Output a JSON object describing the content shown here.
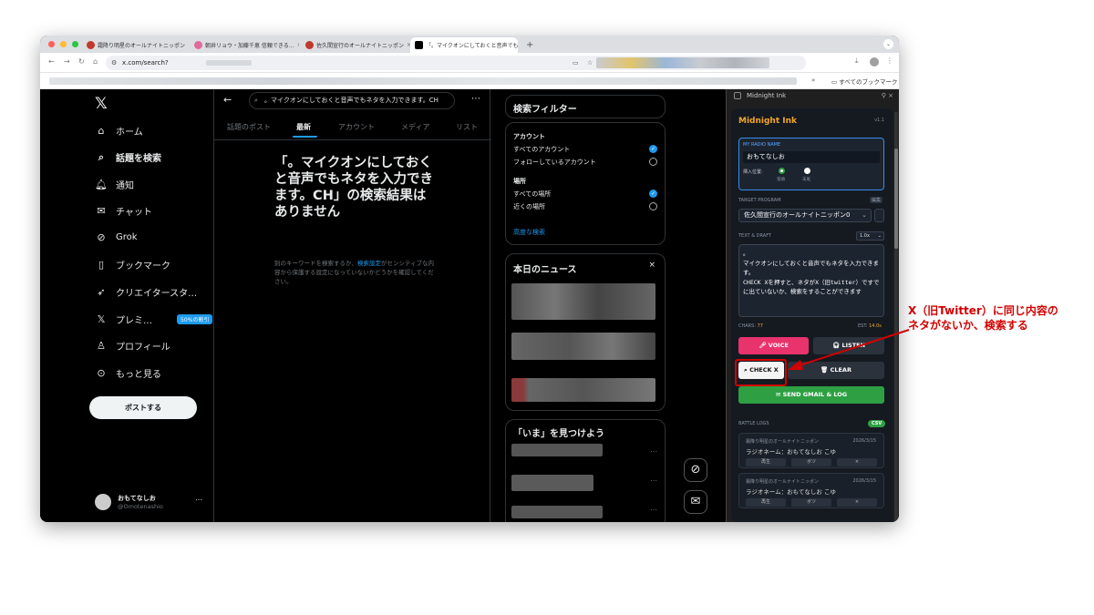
{
  "browser": {
    "tabs": [
      {
        "label": "霜降り明星のオールナイトニッポン"
      },
      {
        "label": "朝井リョウ・加藤千恵 信頼できる…"
      },
      {
        "label": "佐久間宣行のオールナイトニッポン"
      },
      {
        "label": "「。マイクオンにしておくと音声でも…"
      }
    ],
    "url": "x.com/search?",
    "bookmarks_all": "すべてのブックマーク"
  },
  "sidebar": {
    "items": [
      {
        "label": "ホーム",
        "icon": "home-icon"
      },
      {
        "label": "話題を検索",
        "icon": "search-icon"
      },
      {
        "label": "通知",
        "icon": "bell-icon"
      },
      {
        "label": "チャット",
        "icon": "mail-icon"
      },
      {
        "label": "Grok",
        "icon": "grok-icon"
      },
      {
        "label": "ブックマーク",
        "icon": "bookmark-icon"
      },
      {
        "label": "クリエイタースタ…",
        "icon": "rocket-icon"
      },
      {
        "label": "プレミ…",
        "icon": "x-logo-icon"
      },
      {
        "label": "プロフィール",
        "icon": "person-icon"
      },
      {
        "label": "もっと見る",
        "icon": "more-icon"
      }
    ],
    "premium_badge": "50%の割引",
    "post_button": "ポストする",
    "profile": {
      "name": "おもてなしお",
      "handle": "@Omotenashio"
    }
  },
  "search": {
    "query": "。マイクオンにしておくと音声でもネタを入力できます。CH",
    "tabs": [
      "話題のポスト",
      "最新",
      "アカウント",
      "メディア",
      "リスト"
    ],
    "active_tab": "最新",
    "no_result_title": "「。マイクオンにしておくと音声でもネタを入力できます。CH」の検索結果はありません",
    "no_result_sub_pre": "別のキーワードを検索するか、",
    "no_result_sub_link": "検索設定",
    "no_result_sub_post": "がセンシティブな内容から保護する設定になっていないかどうかを確認してください。"
  },
  "filters": {
    "title": "検索フィルター",
    "account_label": "アカウント",
    "account_opt1": "すべてのアカウント",
    "account_opt2": "フォローしているアカウント",
    "place_label": "場所",
    "place_opt1": "すべての場所",
    "place_opt2": "近くの場所",
    "advanced": "高度な検索"
  },
  "news": {
    "title": "本日のニュース"
  },
  "discover": {
    "title": "「いま」を見つけよう"
  },
  "extension": {
    "header": "Midnight Ink",
    "title": "Midnight Ink",
    "version": "v1.1",
    "radio_name_label": "MY RADIO NAME",
    "radio_name": "おもてなしお",
    "position_label": "挿入位置:",
    "pos_opt1": "冒頭",
    "pos_opt2": "末尾",
    "target_label": "TARGET PROGRAM",
    "edit_label": "編集",
    "target_program": "佐久間宣行のオールナイトニッポン0",
    "draft_label": "TEXT & DRAFT",
    "speed": "1.0x",
    "draft_text": "。\nマイクオンにしておくと音声でもネタを入力できます。\nCHECK Xを押すと、ネタがX（旧twitter）ですでに出ていないか、検索をすることができます",
    "chars_label": "CHARS:",
    "chars_value": "77",
    "est_label": "EST:",
    "est_value": "14.0s",
    "voice_btn": "VOICE",
    "listen_btn": "LISTEN",
    "checkx_btn": "CHECK X",
    "clear_btn": "CLEAR",
    "send_btn": "SEND GMAIL & LOG",
    "logs_label": "BATTLE LOGS",
    "csv_label": "CSV",
    "logs": [
      {
        "program": "霜降り明星のオールナイトニッポン",
        "date": "2026/3/15",
        "radio": "ラジオネーム：おもてなしお こゆ",
        "b1": "再生",
        "b2": "ボツ",
        "b3": "×"
      },
      {
        "program": "霜降り明星のオールナイトニッポン",
        "date": "2026/3/15",
        "radio": "ラジオネーム：おもてなしお こゆ",
        "b1": "再生",
        "b2": "ボツ",
        "b3": "×"
      }
    ]
  },
  "annotation": {
    "line1": "X（旧Twitter）に同じ内容の",
    "line2": "ネタがないか、検索する",
    "color": "#d20000"
  },
  "colors": {
    "x_blue": "#1d9bf0",
    "voice": "#e8336d",
    "send": "#2ea043",
    "accent": "#f5a623"
  }
}
